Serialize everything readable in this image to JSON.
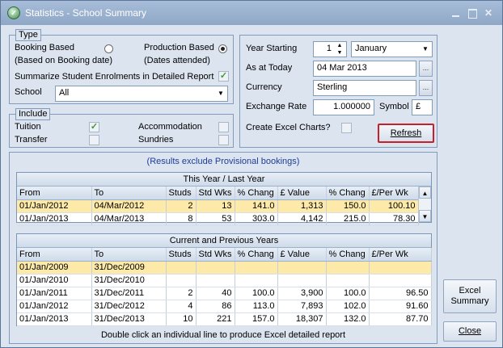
{
  "window": {
    "title": "Statistics - School Summary",
    "icon": "app-logo-icon"
  },
  "type_group": {
    "legend": "Type",
    "booking_based": "Booking Based",
    "booking_based_note": "(Based on Booking date)",
    "production_based": "Production Based",
    "production_based_note": "(Dates attended)",
    "selected": "production_based",
    "summarize_label": "Summarize Student Enrolments in Detailed Report",
    "summarize_checked": true,
    "school_label": "School",
    "school_value": "All"
  },
  "include_group": {
    "legend": "Include",
    "tuition": "Tuition",
    "tuition_checked": true,
    "accommodation": "Accommodation",
    "accommodation_checked": false,
    "transfer": "Transfer",
    "transfer_checked": false,
    "sundries": "Sundries",
    "sundries_checked": false
  },
  "options": {
    "year_starting_label": "Year Starting",
    "year_day": "1",
    "year_month": "January",
    "as_at_label": "As at Today",
    "as_at_value": "04 Mar 2013",
    "currency_label": "Currency",
    "currency_value": "Sterling",
    "exchange_label": "Exchange Rate",
    "exchange_value": "1.000000",
    "symbol_label": "Symbol",
    "symbol_value": "£",
    "excel_charts_label": "Create Excel Charts?",
    "excel_charts_checked": false,
    "refresh_label": "Refresh"
  },
  "results": {
    "note": "(Results exclude Provisional bookings)",
    "footer_note": "Double click an individual line to produce Excel detailed report"
  },
  "table1": {
    "title": "This Year / Last Year",
    "columns": [
      "From",
      "To",
      "Studs",
      "Std Wks",
      "% Chang",
      "£ Value",
      "% Chang",
      "£/Per Wk"
    ],
    "rows": [
      [
        "01/Jan/2012",
        "04/Mar/2012",
        "2",
        "13",
        "141.0",
        "1,313",
        "150.0",
        "100.10"
      ],
      [
        "01/Jan/2013",
        "04/Mar/2013",
        "8",
        "53",
        "303.0",
        "4,142",
        "215.0",
        "78.30"
      ]
    ]
  },
  "table2": {
    "title": "Current and Previous Years",
    "columns": [
      "From",
      "To",
      "Studs",
      "Std Wks",
      "% Chang",
      "£ Value",
      "% Chang",
      "£/Per Wk"
    ],
    "rows": [
      [
        "01/Jan/2009",
        "31/Dec/2009",
        "",
        "",
        "",
        "",
        "",
        ""
      ],
      [
        "01/Jan/2010",
        "31/Dec/2010",
        "",
        "",
        "",
        "",
        "",
        ""
      ],
      [
        "01/Jan/2011",
        "31/Dec/2011",
        "2",
        "40",
        "100.0",
        "3,900",
        "100.0",
        "96.50"
      ],
      [
        "01/Jan/2012",
        "31/Dec/2012",
        "4",
        "86",
        "113.0",
        "7,893",
        "102.0",
        "91.60"
      ],
      [
        "01/Jan/2013",
        "31/Dec/2013",
        "10",
        "221",
        "157.0",
        "18,307",
        "132.0",
        "87.70"
      ]
    ]
  },
  "buttons": {
    "excel_summary": "Excel Summary",
    "close": "Close"
  }
}
